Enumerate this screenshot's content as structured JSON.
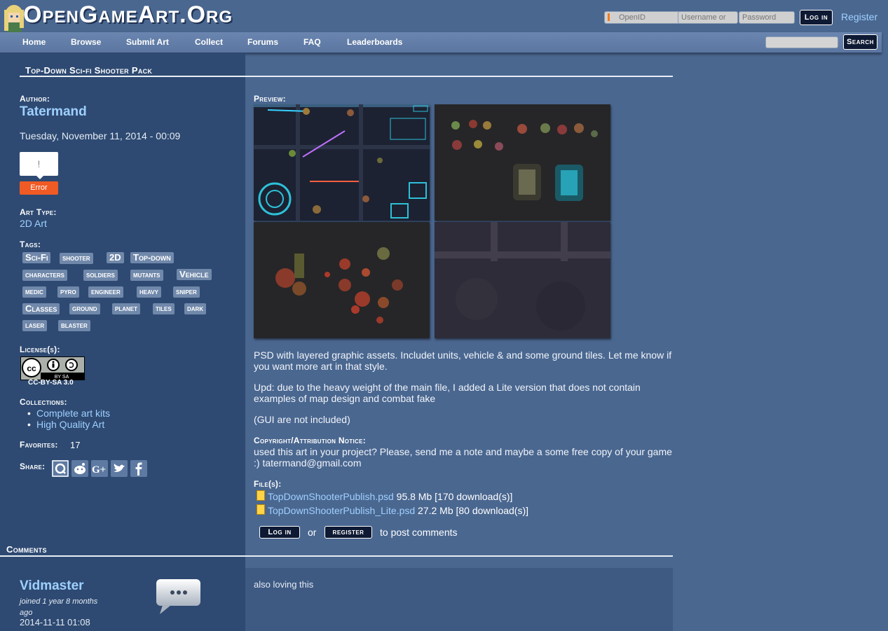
{
  "site": {
    "title": "OpenGameArt.Org"
  },
  "login": {
    "openid_placeholder": "OpenID",
    "username_placeholder": "Username or",
    "password_placeholder": "Password",
    "login_label": "Log in",
    "register_label": "Register"
  },
  "nav": {
    "items": [
      "Home",
      "Browse",
      "Submit Art",
      "Collect",
      "Forums",
      "FAQ",
      "Leaderboards"
    ],
    "search_label": "Search"
  },
  "node": {
    "title": "Top-Down Sci-fi Shooter Pack",
    "author_label": "Author:",
    "author": "Tatermand",
    "date": "Tuesday, November 11, 2014 - 00:09",
    "widget_glyph": "!",
    "widget_error": "Error",
    "art_type_label": "Art Type:",
    "art_type": "2D Art",
    "tags_label": "Tags:",
    "tags": [
      "Sci-Fi",
      "shooter",
      "2D",
      "Top-down",
      "characters",
      "soldiers",
      "mutants",
      "Vehicle",
      "medic",
      "pyro",
      "engineer",
      "heavy",
      "sniper",
      "Classes",
      "ground",
      "planet",
      "tiles",
      "dark",
      "laser",
      "blaster"
    ],
    "license_label": "License(s):",
    "license": "CC-BY-SA 3.0",
    "license_badge_text": "BY  SA",
    "collections_label": "Collections:",
    "collections": [
      "Complete art kits",
      "High Quality Art"
    ],
    "favorites_label": "Favorites:",
    "favorites": "17",
    "share_label": "Share:",
    "preview_label": "Preview:",
    "description": [
      "PSD with layered graphic assets. Includet units, vehicle & and some ground tiles. Let me know if you want more art in that style.",
      "Upd: due to the heavy weight of the main file, I added a Lite version that does not contain examples of map design and combat fake",
      "(GUI are not included)"
    ],
    "copyright_label": "Copyright/Attribution Notice:",
    "copyright": "used this art in your project? Please, send me a note and maybe a some free copy of your game :) tatermand@gmail.com",
    "files_label": "File(s):",
    "files": [
      {
        "name": "TopDownShooterPublish.psd",
        "info": "95.8 Mb [170 download(s)]"
      },
      {
        "name": "TopDownShooterPublish_Lite.psd",
        "info": "27.2 Mb [80 download(s)]"
      }
    ],
    "post_login_label": "Log in",
    "post_or": "or",
    "post_register_label": "register",
    "post_suffix": "to post comments"
  },
  "comments": {
    "title": "Comments",
    "items": [
      {
        "author": "Vidmaster",
        "joined": "joined 1 year 8 months ago",
        "date": "2014-11-11 01:08",
        "body": "also loving this"
      }
    ]
  }
}
